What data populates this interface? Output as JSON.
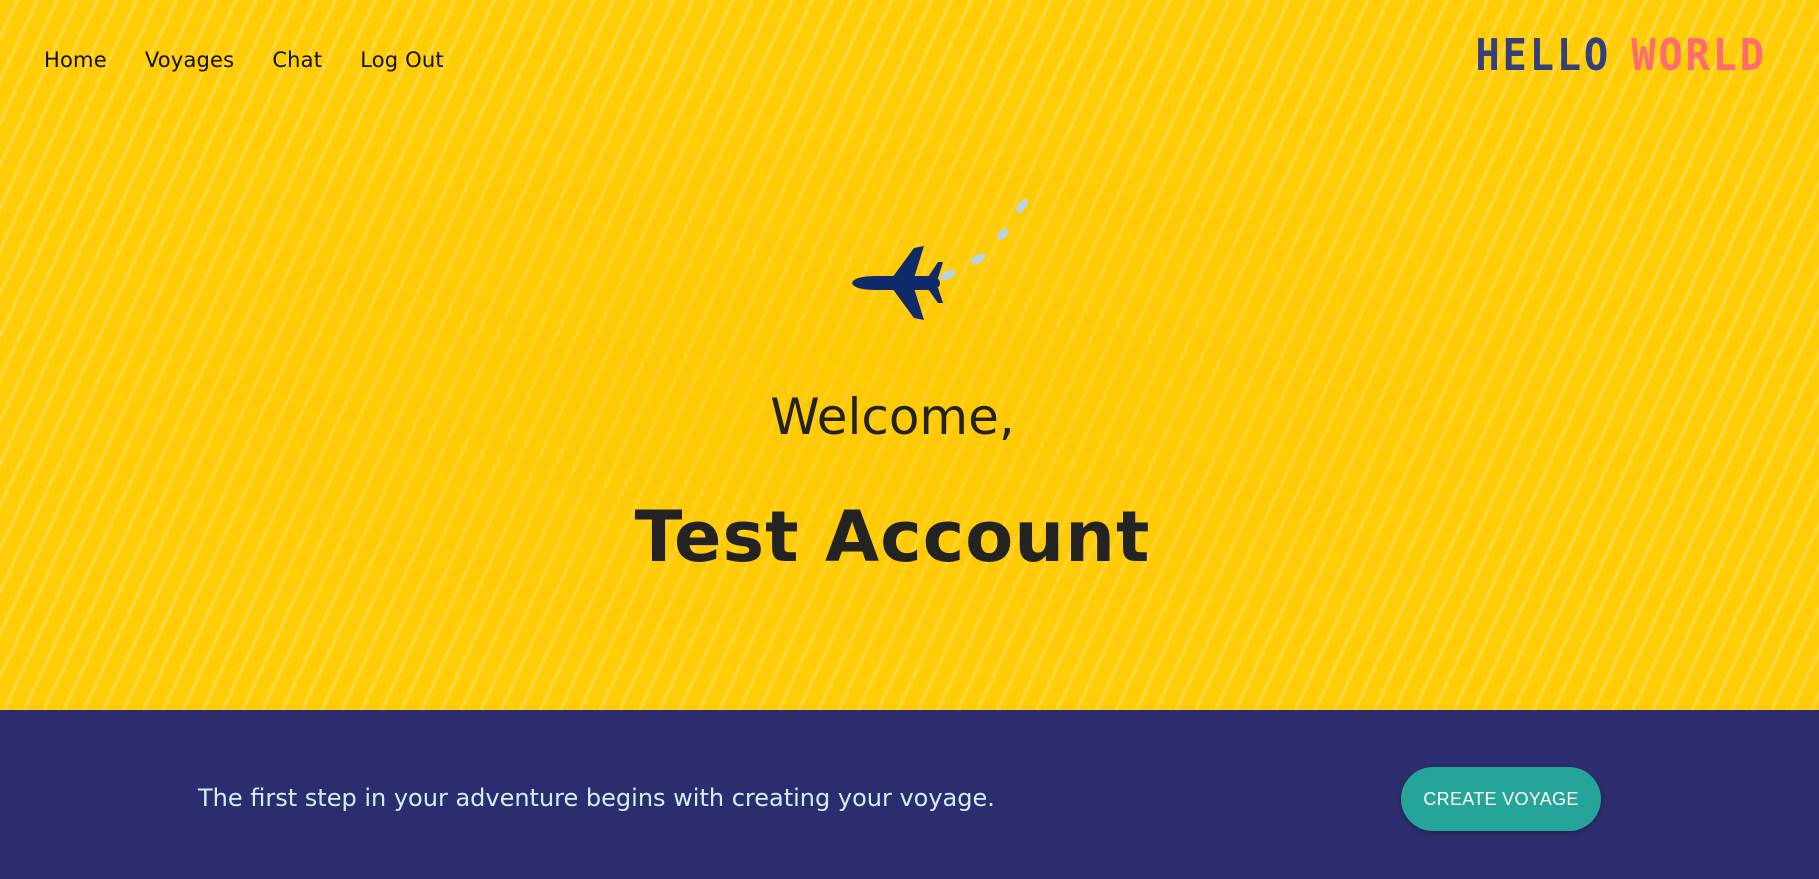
{
  "nav": {
    "items": [
      {
        "label": "Home"
      },
      {
        "label": "Voyages"
      },
      {
        "label": "Chat"
      },
      {
        "label": "Log Out"
      }
    ]
  },
  "logo": {
    "word1": "HELLO",
    "word2": "WORLD"
  },
  "hero": {
    "icon": "airplane-icon",
    "welcome": "Welcome,",
    "username": "Test Account"
  },
  "cta": {
    "text": "The first step in your adventure begins with creating your voyage.",
    "button_label": "CREATE VOYAGE"
  },
  "colors": {
    "hero_background": "#ffcc08",
    "band_background": "#2b2d6e",
    "button": "#25a59a",
    "logo_hello": "#35407a",
    "logo_world": "#ff6b6f",
    "plane": "#0e2a6b"
  }
}
